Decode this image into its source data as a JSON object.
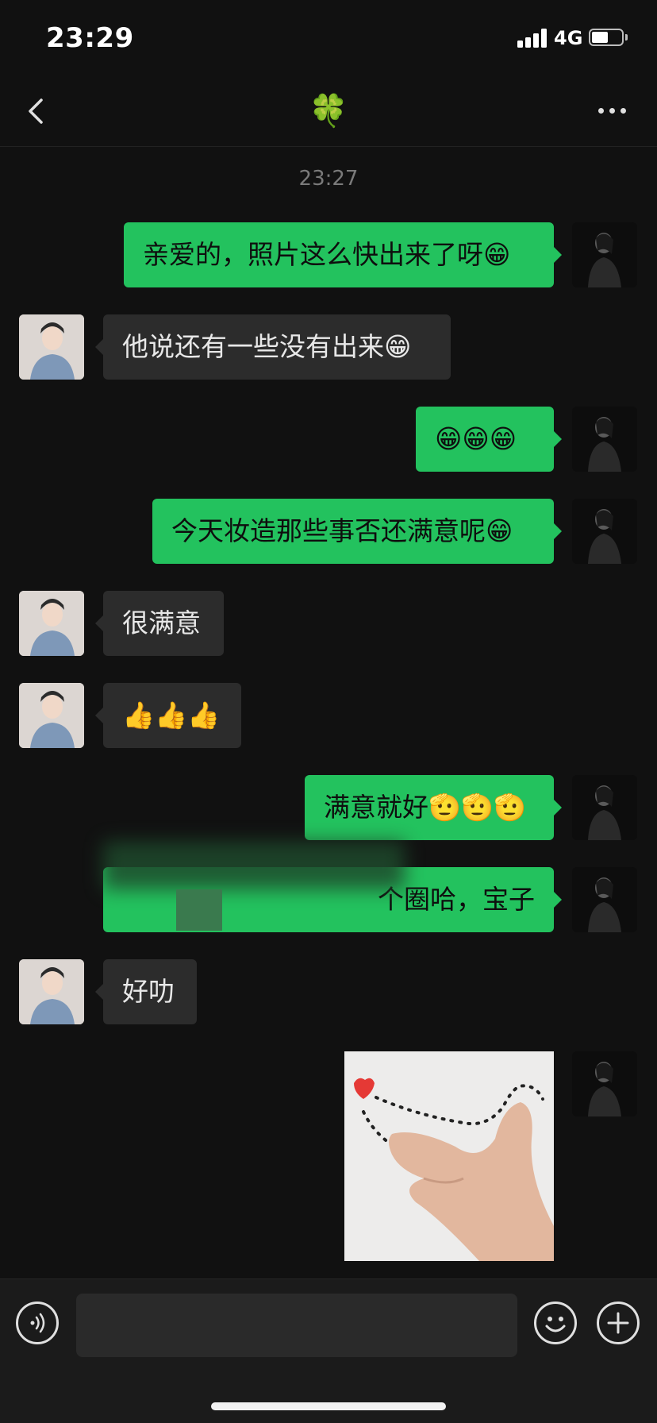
{
  "status_bar": {
    "time": "23:29",
    "network": "4G"
  },
  "nav": {
    "title": "🍀"
  },
  "timestamp": "23:27",
  "messages": [
    {
      "from": "self",
      "text": "亲爱的，照片这么快出来了呀😁"
    },
    {
      "from": "other",
      "text": "他说还有一些没有出来😁"
    },
    {
      "from": "self",
      "text": "😁😁😁"
    },
    {
      "from": "self",
      "text": "今天妆造那些事否还满意呢😁"
    },
    {
      "from": "other",
      "text": "很满意"
    },
    {
      "from": "other",
      "text": "👍👍👍"
    },
    {
      "from": "self",
      "text": "满意就好🫡🫡🫡"
    },
    {
      "from": "self",
      "text": "个圈哈，宝子"
    },
    {
      "from": "other",
      "text": "好叻"
    },
    {
      "from": "self",
      "type": "image"
    }
  ],
  "colors": {
    "outgoing_bubble": "#23c25e",
    "incoming_bubble": "#2c2c2c",
    "background": "#111111"
  },
  "input": {
    "value": "",
    "placeholder": ""
  },
  "icons": [
    "back-icon",
    "more-icon",
    "voice-icon",
    "emoji-icon",
    "plus-icon"
  ]
}
